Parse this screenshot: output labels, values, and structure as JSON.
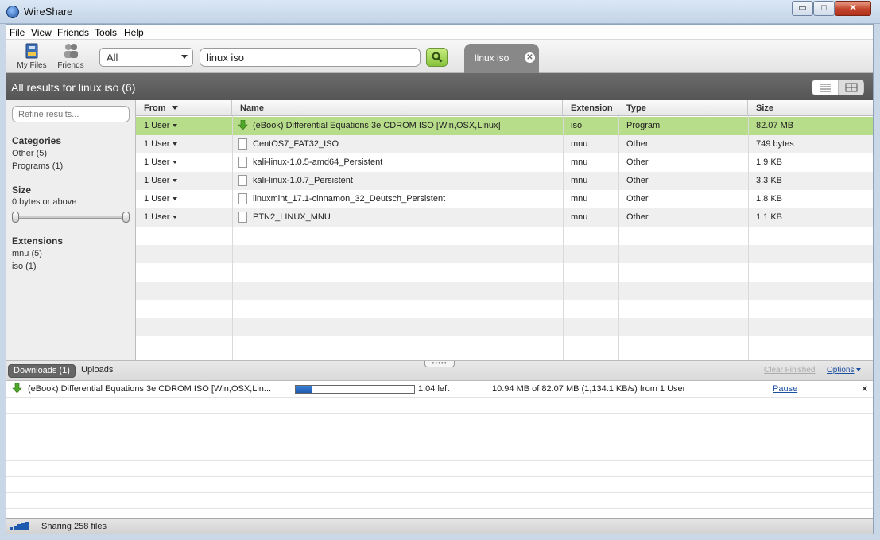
{
  "window": {
    "title": "WireShare",
    "minimize": "▭",
    "maximize": "□",
    "close": "✕"
  },
  "menu": [
    "File",
    "View",
    "Friends",
    "Tools",
    "Help"
  ],
  "toolbar": {
    "my_files": "My Files",
    "friends": "Friends",
    "search_category": "All",
    "search_query": "linux iso",
    "search_tab_label": "linux iso"
  },
  "results": {
    "title": "All results for linux iso (6)",
    "refine_placeholder": "Refine results...",
    "columns": {
      "from": "From",
      "name": "Name",
      "extension": "Extension",
      "type": "Type",
      "size": "Size"
    },
    "rows": [
      {
        "from": "1 User",
        "name": "(eBook) Differential Equations 3e CDROM ISO [Win,OSX,Linux]",
        "extension": "iso",
        "type": "Program",
        "size": "82.07 MB",
        "icon": "download-arrow-icon"
      },
      {
        "from": "1 User",
        "name": "CentOS7_FAT32_ISO",
        "extension": "mnu",
        "type": "Other",
        "size": "749 bytes",
        "icon": "file-icon"
      },
      {
        "from": "1 User",
        "name": "kali-linux-1.0.5-amd64_Persistent",
        "extension": "mnu",
        "type": "Other",
        "size": "1.9 KB",
        "icon": "file-icon"
      },
      {
        "from": "1 User",
        "name": "kali-linux-1.0.7_Persistent",
        "extension": "mnu",
        "type": "Other",
        "size": "3.3 KB",
        "icon": "file-icon"
      },
      {
        "from": "1 User",
        "name": "linuxmint_17.1-cinnamon_32_Deutsch_Persistent",
        "extension": "mnu",
        "type": "Other",
        "size": "1.8 KB",
        "icon": "file-icon"
      },
      {
        "from": "1 User",
        "name": "PTN2_LINUX_MNU",
        "extension": "mnu",
        "type": "Other",
        "size": "1.1 KB",
        "icon": "file-icon"
      }
    ]
  },
  "sidebar": {
    "categories_title": "Categories",
    "categories": [
      "Other (5)",
      "Programs (1)"
    ],
    "size_title": "Size",
    "size_value": "0 bytes or above",
    "extensions_title": "Extensions",
    "extensions": [
      "mnu (5)",
      "iso (1)"
    ]
  },
  "downloads": {
    "tab_downloads": "Downloads (1)",
    "tab_uploads": "Uploads",
    "clear_finished": "Clear Finished",
    "options": "Options",
    "item": {
      "name": "(eBook) Differential Equations 3e CDROM ISO [Win,OSX,Lin...",
      "progress": 0.133,
      "time_left": "1:04 left",
      "stats": "10.94 MB of 82.07 MB (1,134.1 KB/s) from 1 User",
      "pause": "Pause",
      "remove": "×"
    }
  },
  "status": {
    "text": "Sharing 258 files"
  },
  "colors": {
    "selected_row": "#b7dc8a",
    "header_bar": "#5e5e5e",
    "link": "#1d4fa0",
    "progress": "#1e5bb0"
  }
}
